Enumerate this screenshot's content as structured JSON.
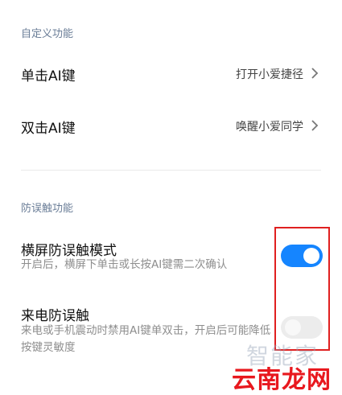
{
  "sections": {
    "custom_title": "自定义功能",
    "anti_mistouch_title": "防误触功能"
  },
  "single_click": {
    "label": "单击AI键",
    "value": "打开小爱捷径"
  },
  "double_click": {
    "label": "双击AI键",
    "value": "唤醒小爱同学"
  },
  "landscape_mode": {
    "label": "横屏防误触模式",
    "description": "开启后，横屏下单击或长按AI键需二次确认",
    "enabled": true
  },
  "incoming_call": {
    "label": "来电防误触",
    "description": "来电或手机震动时禁用AI键单双击，开启后可能降低按键灵敏度",
    "enabled": false
  },
  "watermark": {
    "top": "智能家",
    "bottom": "云南龙网"
  },
  "colors": {
    "accent": "#1585ff",
    "highlight": "#e02020",
    "section": "#6a7d97"
  }
}
